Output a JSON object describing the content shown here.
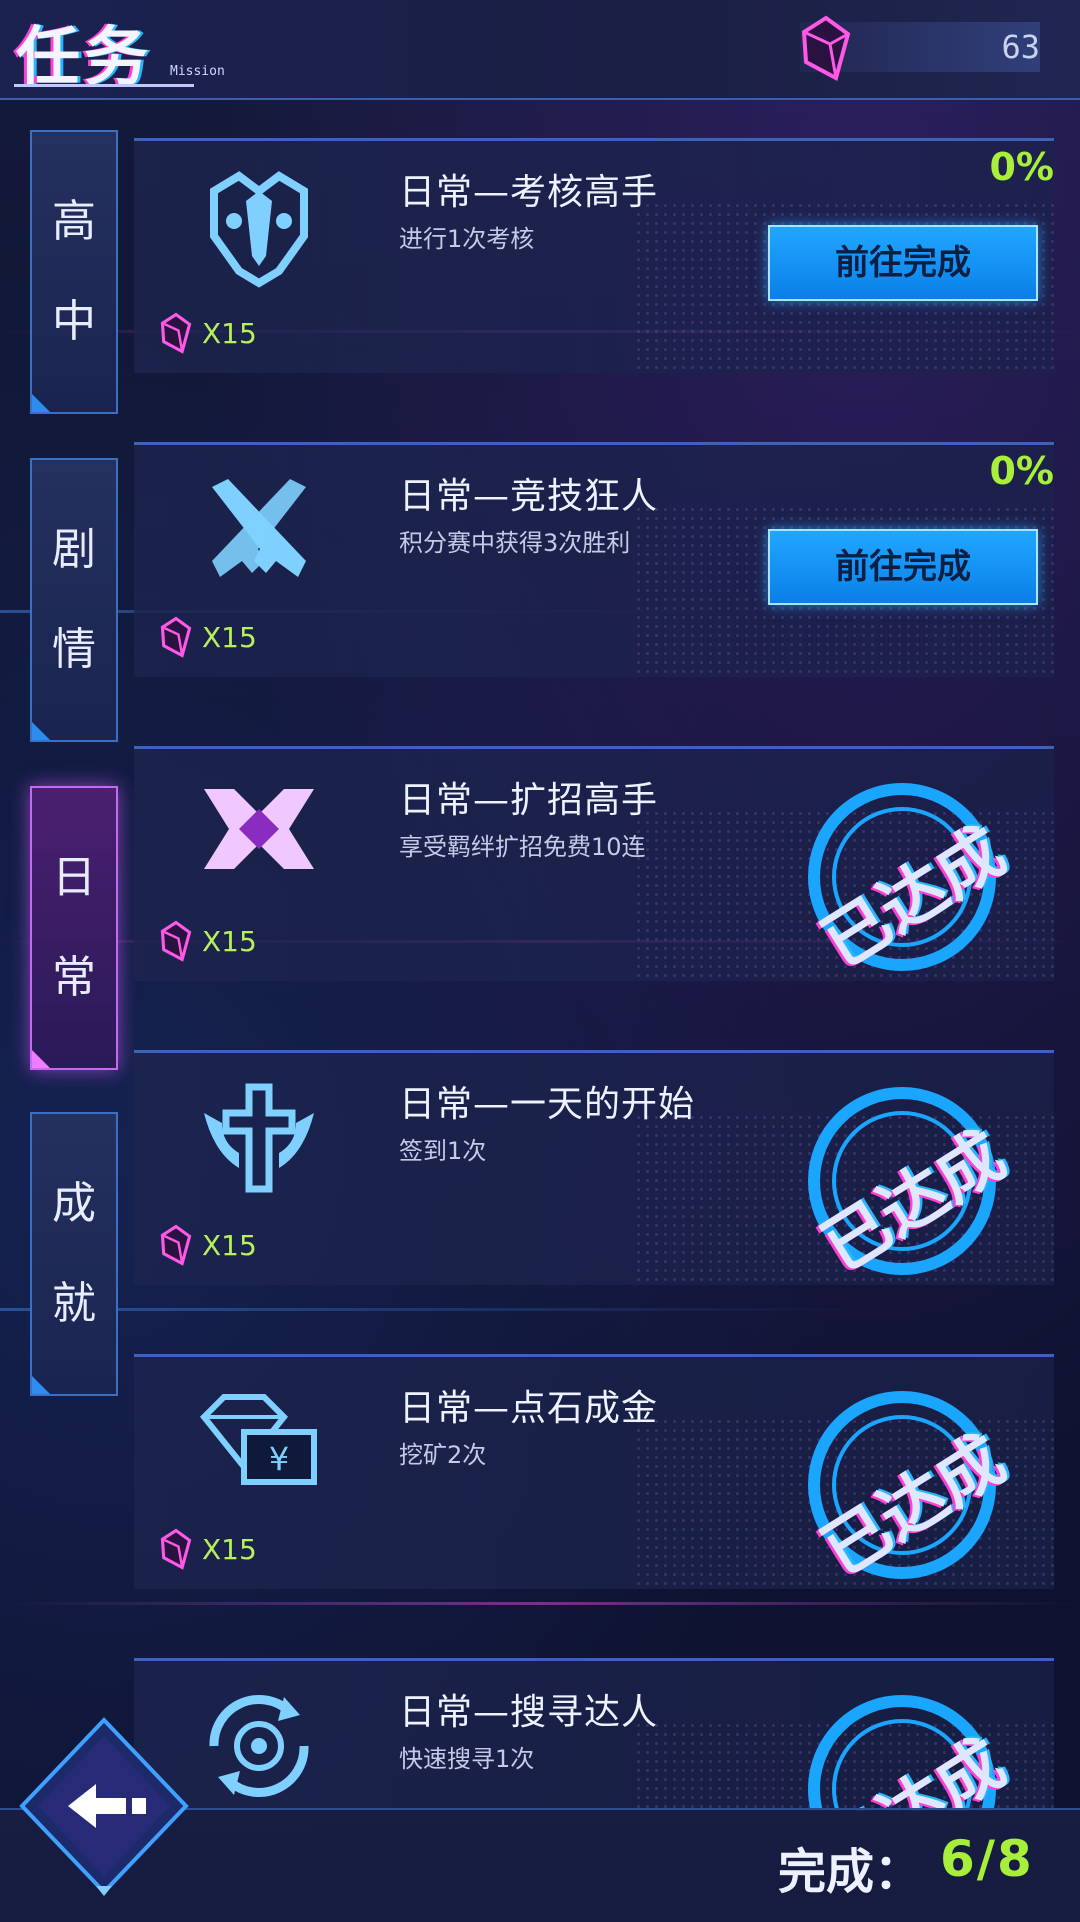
{
  "header": {
    "title": "任务",
    "subtitle": "Mission",
    "gem_count": "63"
  },
  "tabs": [
    {
      "label": [
        "高",
        "中"
      ],
      "active": false
    },
    {
      "label": [
        "剧",
        "情"
      ],
      "active": false
    },
    {
      "label": [
        "日",
        "常"
      ],
      "active": true
    },
    {
      "label": [
        "成",
        "就"
      ],
      "active": false
    }
  ],
  "tasks": [
    {
      "title": "日常—考核高手",
      "desc": "进行1次考核",
      "reward": "X15",
      "progress": "0%",
      "button": "前往完成",
      "done": false,
      "icon": "mask-icon"
    },
    {
      "title": "日常—竞技狂人",
      "desc": "积分赛中获得3次胜利",
      "reward": "X15",
      "progress": "0%",
      "button": "前往完成",
      "done": false,
      "icon": "crossed-guns-icon"
    },
    {
      "title": "日常—扩招高手",
      "desc": "享受羁绊扩招免费10连",
      "reward": "X15",
      "stamp": "已达成",
      "done": true,
      "icon": "crest-icon"
    },
    {
      "title": "日常—一天的开始",
      "desc": "签到1次",
      "reward": "X15",
      "stamp": "已达成",
      "done": true,
      "icon": "cross-emblem-icon"
    },
    {
      "title": "日常—点石成金",
      "desc": "挖矿2次",
      "reward": "X15",
      "stamp": "已达成",
      "done": true,
      "icon": "diamond-money-icon"
    },
    {
      "title": "日常—搜寻达人",
      "desc": "快速搜寻1次",
      "stamp": "已达成",
      "done": true,
      "icon": "target-refresh-icon"
    }
  ],
  "footer": {
    "complete_label": "完成：",
    "complete_value": "6/8"
  },
  "colors": {
    "accent_green": "#a8ef3c",
    "accent_blue": "#21a7ff",
    "accent_magenta": "#ff3fd6"
  }
}
